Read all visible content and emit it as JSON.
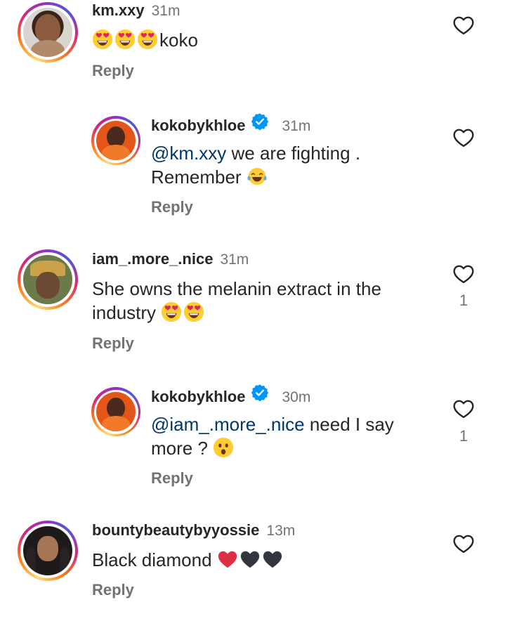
{
  "comments": [
    {
      "username": "km.xxy",
      "time": "31m",
      "text_suffix": "koko",
      "reply_label": "Reply",
      "emojis": [
        "heart-eyes",
        "heart-eyes",
        "heart-eyes"
      ]
    },
    {
      "username": "kokobykhloe",
      "time": "31m",
      "mention": "@km.xxy",
      "text": " we are fighting .",
      "text_line2": "Remember",
      "reply_label": "Reply",
      "verified": true,
      "emojis": [
        "tears-of-joy"
      ]
    },
    {
      "username": "iam_.more_.nice",
      "time": "31m",
      "text": "She owns the melanin extract in the",
      "text_line2": "industry",
      "reply_label": "Reply",
      "likes": "1",
      "emojis": [
        "heart-eyes",
        "heart-eyes"
      ]
    },
    {
      "username": "kokobykhloe",
      "time": "30m",
      "mention": "@iam_.more_.nice",
      "text": " need I say",
      "text_line2": "more ?",
      "reply_label": "Reply",
      "verified": true,
      "likes": "1",
      "emojis": [
        "astonished"
      ]
    },
    {
      "username": "bountybeautybyyossie",
      "time": "13m",
      "text": "Black diamond",
      "reply_label": "Reply",
      "emojis": [
        "red-heart",
        "black-heart",
        "black-heart"
      ]
    }
  ],
  "colors": {
    "text": "#262626",
    "secondary": "#737373",
    "mention": "#00376b",
    "verified": "#0095f6",
    "ring_gradient": [
      "#feda75",
      "#fa7e1e",
      "#d62976",
      "#962fbf",
      "#4f5bd5"
    ]
  }
}
